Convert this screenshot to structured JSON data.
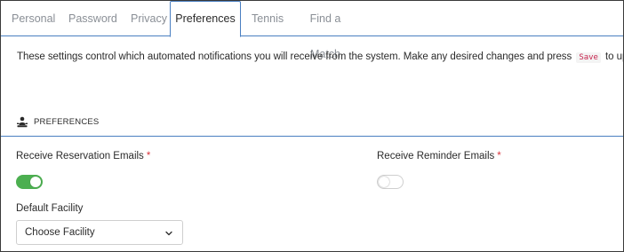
{
  "tabs": [
    {
      "label": "Personal"
    },
    {
      "label": "Password"
    },
    {
      "label": "Privacy"
    },
    {
      "label": "Preferences"
    },
    {
      "label": "Tennis"
    },
    {
      "label": "Find a Match"
    }
  ],
  "intro": {
    "before": "These settings control which automated notifications you will receive from the system. Make any desired changes and press",
    "code": "Save",
    "after": "to update your profile."
  },
  "section": {
    "title": "PREFERENCES",
    "icon": "preferences-person-icon"
  },
  "fields": {
    "reservation_emails": {
      "label": "Receive Reservation Emails",
      "required_mark": "*",
      "enabled": true
    },
    "reminder_emails": {
      "label": "Receive Reminder Emails",
      "required_mark": "*",
      "enabled": false
    },
    "default_facility": {
      "label": "Default Facility",
      "value": "Choose Facility"
    }
  },
  "colors": {
    "accent": "#4a7fc1",
    "toggle_on": "#4caf50",
    "required": "#d9363e"
  }
}
